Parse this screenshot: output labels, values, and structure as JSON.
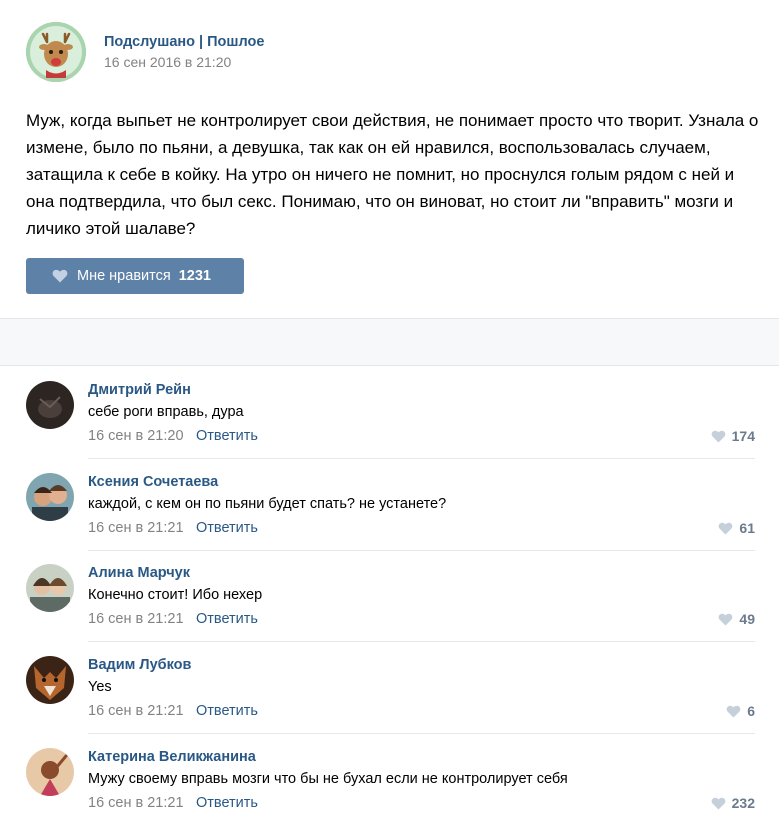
{
  "post": {
    "author": "Подслушано | Пошлое",
    "date": "16 сен 2016 в 21:20",
    "text": "Муж, когда выпьет не контролирует свои действия, не понимает просто что творит. Узнала о измене, было по пьяни, а девушка, так как он ей нравился, воспользовалась случаем, затащила к себе в койку. На утро он ничего не помнит, но проснулся голым рядом с ней и она подтвердила, что был секс. Понимаю, что он виноват, но стоит ли \"вправить\" мозги и личико этой шалаве?",
    "like_label": "Мне нравится",
    "like_count": "1231",
    "avatar_icon": "deer-avatar-icon"
  },
  "comments": [
    {
      "name": "Дмитрий Рейн",
      "text": "себе роги вправь, дура",
      "date": "16 сен в 21:20",
      "reply": "Ответить",
      "likes": "174"
    },
    {
      "name": "Ксения Сочетаева",
      "text": "каждой, с кем он по пьяни будет спать? не устанете?",
      "date": "16 сен в 21:21",
      "reply": "Ответить",
      "likes": "61"
    },
    {
      "name": "Алина Марчук",
      "text": "Конечно стоит! Ибо нехер",
      "date": "16 сен в 21:21",
      "reply": "Ответить",
      "likes": "49"
    },
    {
      "name": "Вадим Лубков",
      "text": "Yes",
      "date": "16 сен в 21:21",
      "reply": "Ответить",
      "likes": "6"
    },
    {
      "name": "Катерина Великжанина",
      "text": "Мужу своему вправь мозги что бы не бухал если не контролирует себя",
      "date": "16 сен в 21:21",
      "reply": "Ответить",
      "likes": "232"
    }
  ],
  "colors": {
    "link": "#2a5885",
    "button": "#5e81a8",
    "muted": "#828282"
  }
}
